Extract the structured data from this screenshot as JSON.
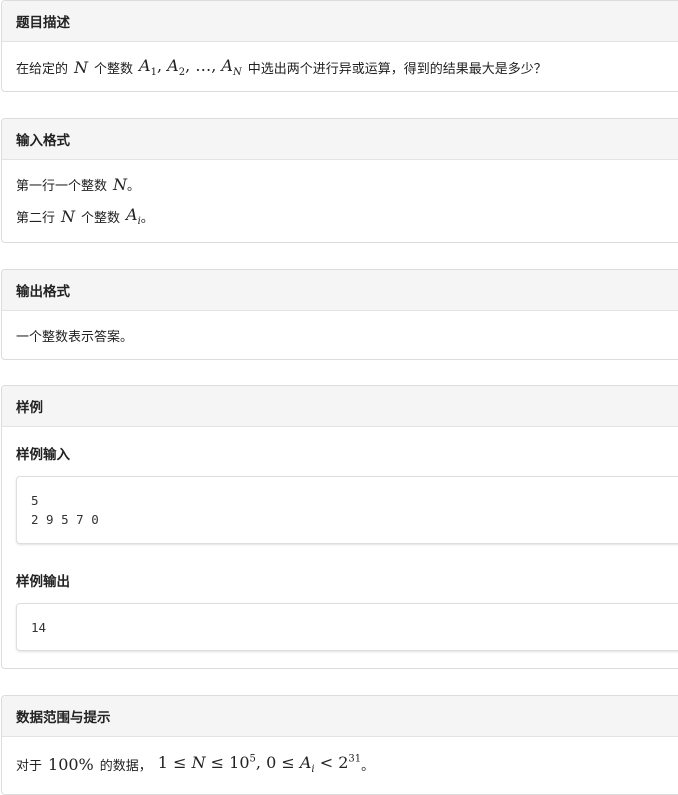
{
  "description": {
    "header": "题目描述",
    "line1": {
      "pre": "在给定的",
      "n": "N",
      "mid": "个整数",
      "a1": "A",
      "a1sub": "1",
      "a2": "A",
      "a2sub": "2",
      "dots": "…",
      "an": "A",
      "ansub": "N",
      "post": "中选出两个进行异或运算，得到的结果最大是多少？"
    }
  },
  "input_format": {
    "header": "输入格式",
    "line1": {
      "pre": "第一行一个整数",
      "n": "N",
      "post": "。"
    },
    "line2": {
      "pre": "第二行",
      "n": "N",
      "mid": "个整数",
      "a": "A",
      "asub": "i",
      "post": "。"
    }
  },
  "output_format": {
    "header": "输出格式",
    "line1": "一个整数表示答案。"
  },
  "sample": {
    "header": "样例",
    "input_label": "样例输入",
    "input_code": "5\n2 9 5 7 0",
    "output_label": "样例输出",
    "output_code": "14"
  },
  "constraints": {
    "header": "数据范围与提示",
    "line1": {
      "pre": "对于",
      "pct": "100%",
      "mid": "的数据，",
      "one": "1",
      "le1": "≤",
      "n": "N",
      "le2": "≤",
      "ten": "10",
      "tenexp": "5",
      "comma": ",",
      "zero": "0",
      "le3": "≤",
      "a": "A",
      "asub": "i",
      "lt": "<",
      "two": "2",
      "twoexp": "31",
      "post": "。"
    }
  }
}
